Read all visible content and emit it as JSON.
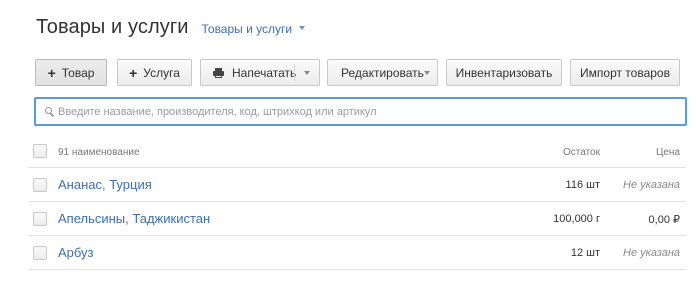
{
  "header": {
    "title": "Товары и услуги",
    "section_selector": "Товары и услуги"
  },
  "toolbar": {
    "add_product": "Товар",
    "add_service": "Услуга",
    "print": "Напечатать",
    "edit": "Редактировать",
    "inventory": "Инвентаризовать",
    "import": "Импорт товаров"
  },
  "search": {
    "value": "",
    "placeholder": "Введите название, производителя, код, штрихкод или артикул"
  },
  "table": {
    "header": {
      "count_label": "91 наименование",
      "stock": "Остаток",
      "price": "Цена"
    },
    "rows": [
      {
        "name": "Ананас, Турция",
        "stock": "116 шт",
        "price": "Не указана",
        "price_missing": true
      },
      {
        "name": "Апельсины, Таджикистан",
        "stock": "100,000 г",
        "price": "0,00 ₽",
        "price_missing": false
      },
      {
        "name": "Арбуз",
        "stock": "12 шт",
        "price": "Не указана",
        "price_missing": true
      }
    ]
  },
  "colors": {
    "link": "#3d6fb0",
    "search_focus_border": "#5b9bd5"
  }
}
